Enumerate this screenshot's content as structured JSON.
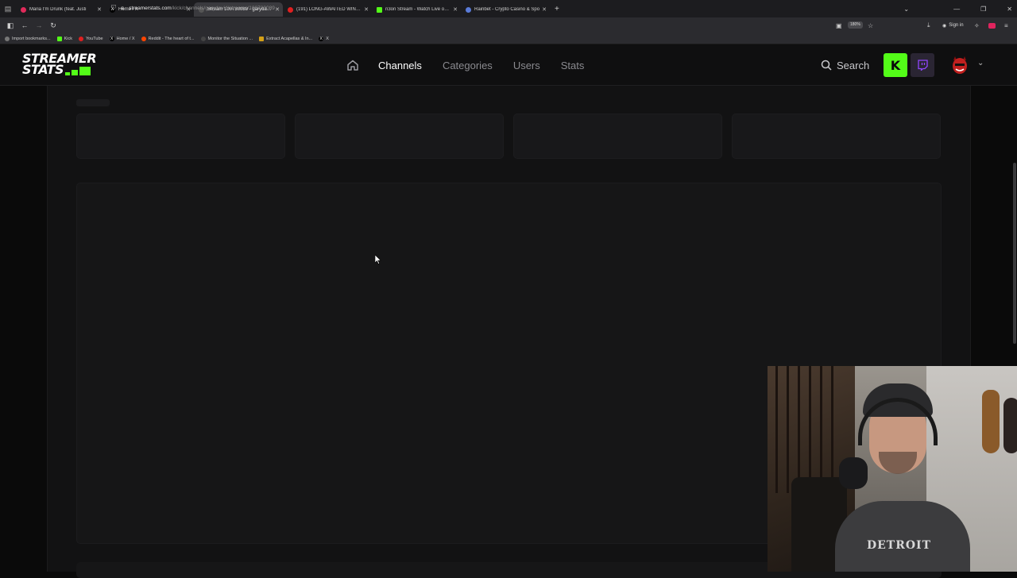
{
  "browser": {
    "tabs": [
      {
        "label": "Maria I'm Drunk (feat. Justi",
        "fav_color": "#e02a5a",
        "active": false
      },
      {
        "label": "Home / X",
        "fav_color": "#000000",
        "active": false
      },
      {
        "label": "Stream 100730089 - garydavid",
        "fav_color": "#3a3a3e",
        "active": true
      },
      {
        "label": "(191) LONG-AWAITED WIN | Dr",
        "fav_color": "#e02020",
        "active": false
      },
      {
        "label": "n3on Stream - Watch Live on K",
        "fav_color": "#53fc18",
        "active": false
      },
      {
        "label": "Rainbet - Crypto Casino & Spo",
        "fav_color": "#5a7bd8",
        "active": false
      }
    ],
    "url_host": "streamerstats.com",
    "url_path": "/kick/channels/garydavid/streams/100730089",
    "zoom": "180%",
    "signin_label": "Sign in",
    "bookmarks": [
      {
        "label": "Import bookmarks...",
        "color": "#777777"
      },
      {
        "label": "Kick",
        "color": "#53fc18"
      },
      {
        "label": "YouTube",
        "color": "#e02020"
      },
      {
        "label": "Home / X",
        "color": "#000000"
      },
      {
        "label": "Reddit - The heart of t...",
        "color": "#ff4500"
      },
      {
        "label": "Monitor the Situation ...",
        "color": "#444444"
      },
      {
        "label": "Extract Acapellas & In...",
        "color": "#d4a017"
      },
      {
        "label": "X",
        "color": "#000000"
      }
    ]
  },
  "site": {
    "logo_line1": "STREAMER",
    "logo_line2": "STATS",
    "nav": [
      {
        "label": "Channels",
        "active": true
      },
      {
        "label": "Categories",
        "active": false
      },
      {
        "label": "Users",
        "active": false
      },
      {
        "label": "Stats",
        "active": false
      }
    ],
    "search_label": "Search",
    "accent": "#53fc18",
    "twitch_color": "#9146ff"
  },
  "icons": {
    "home": "home-icon",
    "search": "search-icon",
    "kick": "kick-icon",
    "twitch": "twitch-icon",
    "avatar": "devil-avatar",
    "dropdown": "chevron-down-icon"
  },
  "content": {
    "state": "loading skeleton",
    "skeleton_cards": 4
  },
  "webcam": {
    "description": "streamer webcam overlay",
    "shirt_text": "DETROIT"
  }
}
